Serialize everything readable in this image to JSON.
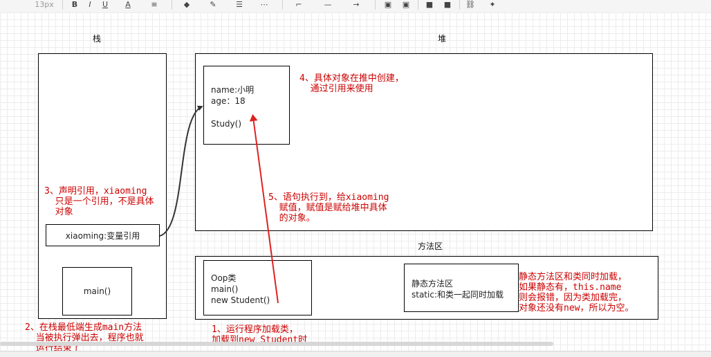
{
  "toolbar": {
    "font_size": "13px",
    "bold": "B",
    "italic": "I",
    "underline": "U",
    "font_color": "A"
  },
  "labels": {
    "stack": "栈",
    "heap": "堆",
    "method_area": "方法区"
  },
  "boxes": {
    "variable_ref": "xiaoming:变量引用",
    "main": "main()",
    "object_lines": [
      "name:小明",
      "age：18",
      "",
      "Study()"
    ],
    "oop_lines": [
      "Oop类",
      "main()",
      "new Student()"
    ],
    "static_lines": [
      "静态方法区",
      "static:和类一起同时加载"
    ]
  },
  "notes": {
    "n1": [
      "1、运行程序加载类，",
      "加载到new Student时"
    ],
    "n2": [
      "2、在栈最低端生成main方法",
      "  当被执行弹出去，程序也就",
      "  运行结束了"
    ],
    "n3": [
      "3、声明引用，xiaoming",
      "  只是一个引用，不是具体",
      "  对象"
    ],
    "n4": [
      "4、具体对象在推中创建，",
      "  通过引用来使用"
    ],
    "n5": [
      "5、语句执行到，给xiaoming",
      "  赋值，赋值是赋给堆中具体",
      "  的对象。"
    ],
    "static_note": [
      "静态方法区和类同时加载，",
      "如果静态有，this.name",
      "则会报错，因为类加载完，",
      "对象还没有new，所以为空。"
    ]
  },
  "colors": {
    "note_red": "#cc0000",
    "arrow_red": "#e02020",
    "arrow_dark": "#333333",
    "border": "#000000"
  }
}
